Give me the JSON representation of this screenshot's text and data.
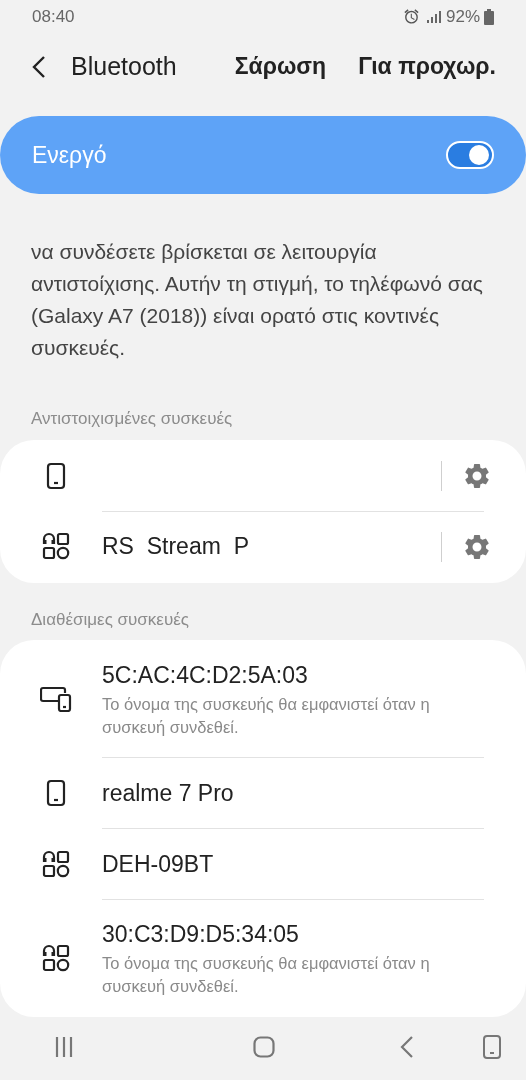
{
  "status_bar": {
    "time": "08:40",
    "battery": "92%"
  },
  "top_bar": {
    "title": "Bluetooth",
    "actions": [
      "Σάρωση",
      "Για προχωρ."
    ]
  },
  "master_switch": {
    "label": "Ενεργό",
    "on": true
  },
  "description": "να συνδέσετε βρίσκεται σε λειτουργία αντιστοίχισης. Αυτήν τη στιγμή, το τηλέφωνό σας (Galaxy A7 (2018)) είναι ορατό στις κοντινές συσκευές.",
  "sections": [
    {
      "title": "Αντιστοιχισμένες συσκευές",
      "devices": [
        {
          "kind": "phone",
          "settings": true
        },
        {
          "kind": "other",
          "name": "RS  Stream  P",
          "settings": true
        }
      ]
    },
    {
      "title": "Διαθέσιμες συσκευές",
      "devices": [
        {
          "kind": "multi",
          "name": "5C:AC:4C:D2:5A:03",
          "note": "Το όνομα της συσκευής θα εμφανιστεί όταν η συσκευή συνδεθεί."
        },
        {
          "kind": "phone",
          "name": "realme 7 Pro"
        },
        {
          "kind": "other",
          "name": "DEH-09BT"
        },
        {
          "kind": "other",
          "name": "30:C3:D9:D5:34:05",
          "note": "Το όνομα της συσκευής θα εμφανιστεί όταν η συσκευή συνδεθεί."
        }
      ]
    }
  ]
}
